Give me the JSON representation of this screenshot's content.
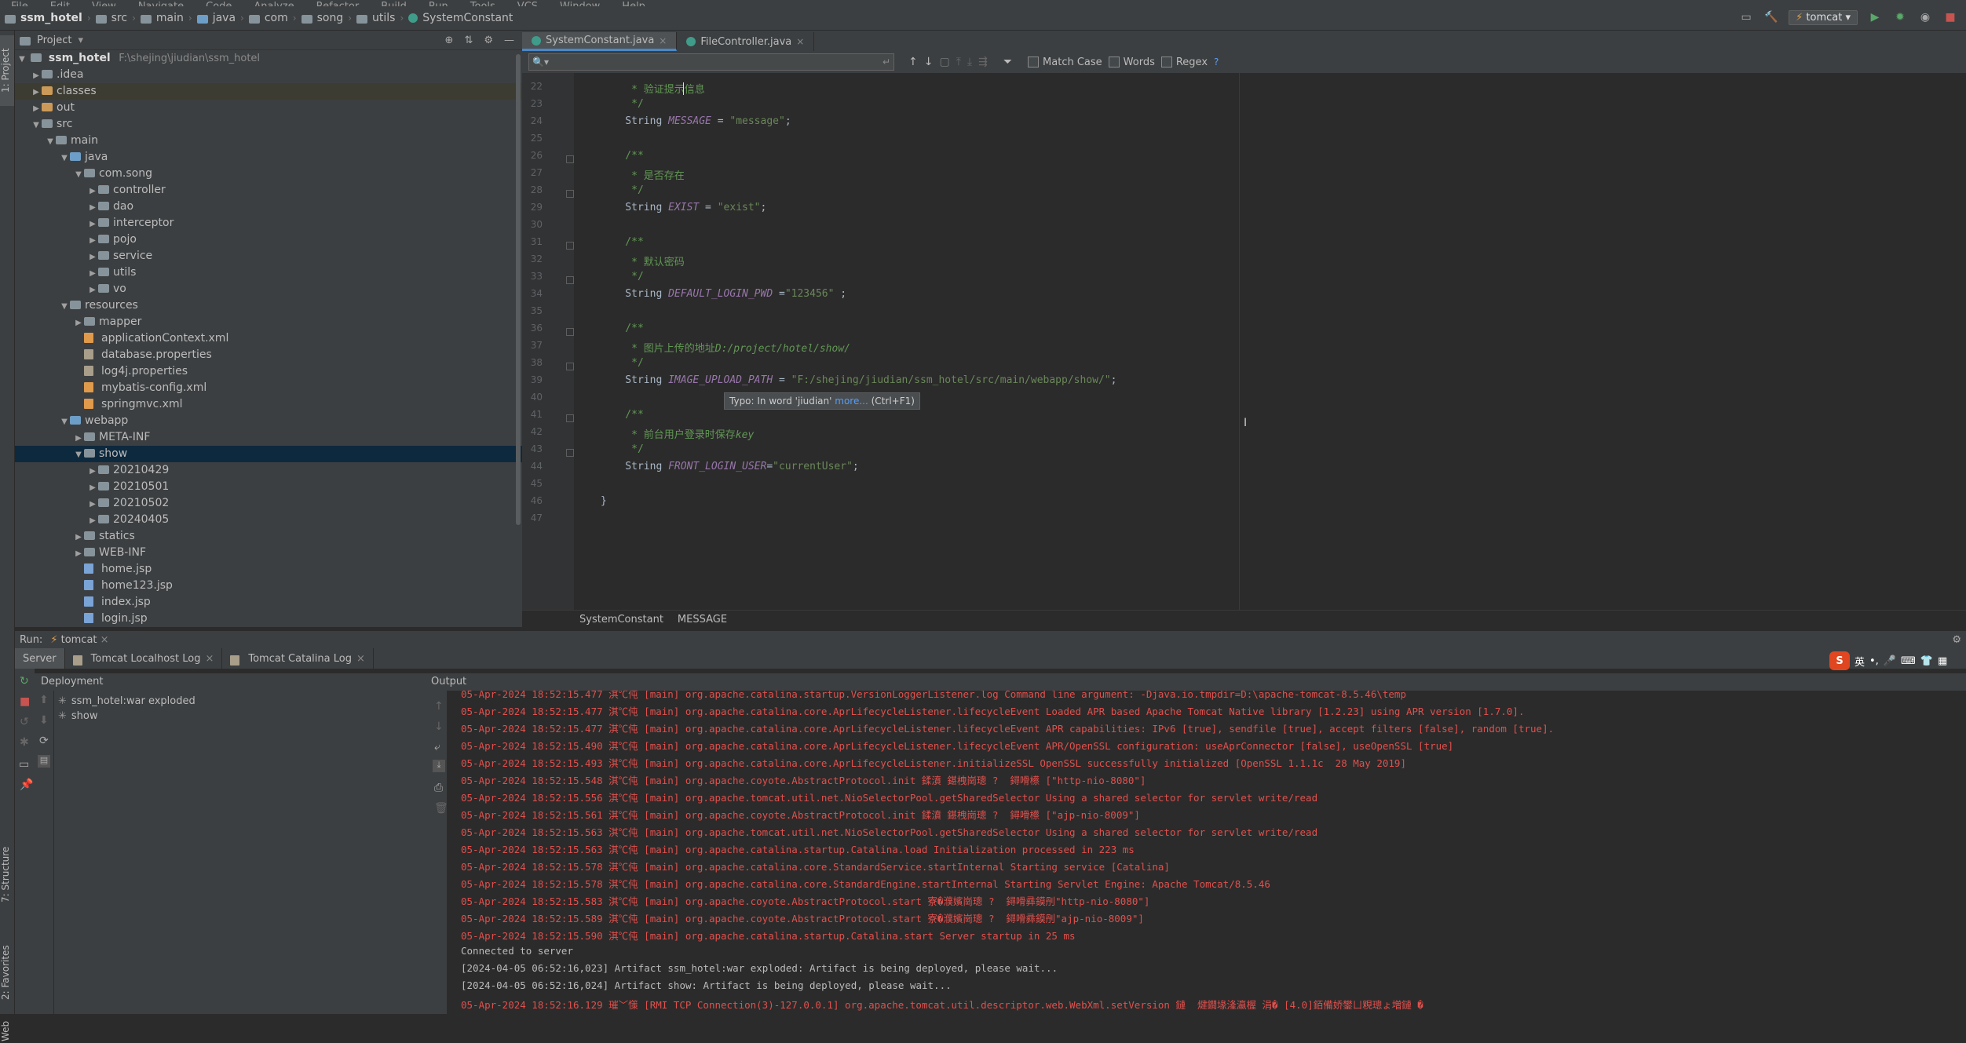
{
  "menubar": [
    "File",
    "Edit",
    "View",
    "Navigate",
    "Code",
    "Analyze",
    "Refactor",
    "Build",
    "Run",
    "Tools",
    "VCS",
    "Window",
    "Help"
  ],
  "navbar": {
    "crumbs": [
      "ssm_hotel",
      "src",
      "main",
      "java",
      "com",
      "song",
      "utils",
      "SystemConstant"
    ],
    "run_config": "tomcat"
  },
  "left_stripe": {
    "project": "1: Project",
    "structure": "7: Structure",
    "favorites": "2: Favorites",
    "web": "Web"
  },
  "project": {
    "title": "Project",
    "root_name": "ssm_hotel",
    "root_path": "F:\\shejing\\jiudian\\ssm_hotel",
    "items": [
      {
        "label": ".idea",
        "depth": 1,
        "kind": "folder",
        "expanded": false
      },
      {
        "label": "classes",
        "depth": 1,
        "kind": "folder-orange",
        "expanded": false
      },
      {
        "label": "out",
        "depth": 1,
        "kind": "folder-orange",
        "expanded": false
      },
      {
        "label": "src",
        "depth": 1,
        "kind": "folder",
        "expanded": true
      },
      {
        "label": "main",
        "depth": 2,
        "kind": "folder",
        "expanded": true
      },
      {
        "label": "java",
        "depth": 3,
        "kind": "folder-blue",
        "expanded": true
      },
      {
        "label": "com.song",
        "depth": 4,
        "kind": "folder",
        "expanded": true
      },
      {
        "label": "controller",
        "depth": 5,
        "kind": "folder",
        "expanded": false
      },
      {
        "label": "dao",
        "depth": 5,
        "kind": "folder",
        "expanded": false
      },
      {
        "label": "interceptor",
        "depth": 5,
        "kind": "folder",
        "expanded": false
      },
      {
        "label": "pojo",
        "depth": 5,
        "kind": "folder",
        "expanded": false
      },
      {
        "label": "service",
        "depth": 5,
        "kind": "folder",
        "expanded": false
      },
      {
        "label": "utils",
        "depth": 5,
        "kind": "folder",
        "expanded": false
      },
      {
        "label": "vo",
        "depth": 5,
        "kind": "folder",
        "expanded": false
      },
      {
        "label": "resources",
        "depth": 3,
        "kind": "folder",
        "expanded": true
      },
      {
        "label": "mapper",
        "depth": 4,
        "kind": "folder",
        "expanded": false
      },
      {
        "label": "applicationContext.xml",
        "depth": 4,
        "kind": "xml"
      },
      {
        "label": "database.properties",
        "depth": 4,
        "kind": "prop"
      },
      {
        "label": "log4j.properties",
        "depth": 4,
        "kind": "prop"
      },
      {
        "label": "mybatis-config.xml",
        "depth": 4,
        "kind": "xml"
      },
      {
        "label": "springmvc.xml",
        "depth": 4,
        "kind": "xml"
      },
      {
        "label": "webapp",
        "depth": 3,
        "kind": "folder-blue",
        "expanded": true
      },
      {
        "label": "META-INF",
        "depth": 4,
        "kind": "folder",
        "expanded": false
      },
      {
        "label": "show",
        "depth": 4,
        "kind": "folder",
        "expanded": true,
        "selected": true
      },
      {
        "label": "20210429",
        "depth": 5,
        "kind": "folder",
        "expanded": false
      },
      {
        "label": "20210501",
        "depth": 5,
        "kind": "folder",
        "expanded": false
      },
      {
        "label": "20210502",
        "depth": 5,
        "kind": "folder",
        "expanded": false
      },
      {
        "label": "20240405",
        "depth": 5,
        "kind": "folder",
        "expanded": false
      },
      {
        "label": "statics",
        "depth": 4,
        "kind": "folder",
        "expanded": false
      },
      {
        "label": "WEB-INF",
        "depth": 4,
        "kind": "folder",
        "expanded": false
      },
      {
        "label": "home.jsp",
        "depth": 4,
        "kind": "jsp"
      },
      {
        "label": "home123.jsp",
        "depth": 4,
        "kind": "jsp"
      },
      {
        "label": "index.jsp",
        "depth": 4,
        "kind": "jsp"
      },
      {
        "label": "login.jsp",
        "depth": 4,
        "kind": "jsp"
      }
    ]
  },
  "editor": {
    "tabs": [
      {
        "label": "SystemConstant.java",
        "active": true
      },
      {
        "label": "FileController.java",
        "active": false
      }
    ],
    "find": {
      "placeholder": "",
      "match_case": "Match Case",
      "words": "Words",
      "regex": "Regex",
      "help": "?"
    },
    "lines": [
      {
        "n": "22",
        "parts": [
          {
            "t": "     * 验证提示信息",
            "c": "cmt"
          }
        ]
      },
      {
        "n": "23",
        "parts": [
          {
            "t": "     */",
            "c": "cmt"
          }
        ]
      },
      {
        "n": "24",
        "parts": [
          {
            "t": "    String ",
            "c": "kw"
          },
          {
            "t": "MESSAGE",
            "c": "ital"
          },
          {
            "t": " = ",
            "c": "kw"
          },
          {
            "t": "\"message\"",
            "c": "str"
          },
          {
            "t": ";",
            "c": "kw"
          }
        ]
      },
      {
        "n": "25",
        "parts": []
      },
      {
        "n": "26",
        "parts": [
          {
            "t": "    /**",
            "c": "cmt"
          }
        ]
      },
      {
        "n": "27",
        "parts": [
          {
            "t": "     * 是否存在",
            "c": "cmt"
          }
        ]
      },
      {
        "n": "28",
        "parts": [
          {
            "t": "     */",
            "c": "cmt"
          }
        ]
      },
      {
        "n": "29",
        "parts": [
          {
            "t": "    String ",
            "c": "kw"
          },
          {
            "t": "EXIST",
            "c": "ital"
          },
          {
            "t": " = ",
            "c": "kw"
          },
          {
            "t": "\"exist\"",
            "c": "str"
          },
          {
            "t": ";",
            "c": "kw"
          }
        ]
      },
      {
        "n": "30",
        "parts": []
      },
      {
        "n": "31",
        "parts": [
          {
            "t": "    /**",
            "c": "cmt"
          }
        ]
      },
      {
        "n": "32",
        "parts": [
          {
            "t": "     * 默认密码",
            "c": "cmt"
          }
        ]
      },
      {
        "n": "33",
        "parts": [
          {
            "t": "     */",
            "c": "cmt"
          }
        ]
      },
      {
        "n": "34",
        "parts": [
          {
            "t": "    String ",
            "c": "kw"
          },
          {
            "t": "DEFAULT_LOGIN_PWD",
            "c": "ital"
          },
          {
            "t": " =",
            "c": "kw"
          },
          {
            "t": "\"123456\"",
            "c": "str"
          },
          {
            "t": " ;",
            "c": "kw"
          }
        ]
      },
      {
        "n": "35",
        "parts": []
      },
      {
        "n": "36",
        "parts": [
          {
            "t": "    /**",
            "c": "cmt"
          }
        ]
      },
      {
        "n": "37",
        "parts": [
          {
            "t": "     * 图片上传的地址",
            "c": "cmt"
          },
          {
            "t": "D:/project/hotel/show/",
            "c": "cmtital"
          }
        ]
      },
      {
        "n": "38",
        "parts": [
          {
            "t": "     */",
            "c": "cmt"
          }
        ]
      },
      {
        "n": "39",
        "parts": [
          {
            "t": "    String ",
            "c": "kw"
          },
          {
            "t": "IMAGE_UPLOAD_PATH",
            "c": "ital"
          },
          {
            "t": " = ",
            "c": "kw"
          },
          {
            "t": "\"F:/shejing/jiudian/ssm_hotel/src/main/webapp/show/\"",
            "c": "str"
          },
          {
            "t": ";",
            "c": "kw"
          }
        ]
      },
      {
        "n": "40",
        "parts": []
      },
      {
        "n": "41",
        "parts": [
          {
            "t": "    /**",
            "c": "cmt"
          }
        ]
      },
      {
        "n": "42",
        "parts": [
          {
            "t": "     * 前台用户登录时保存",
            "c": "cmt"
          },
          {
            "t": "key",
            "c": "cmtital"
          }
        ]
      },
      {
        "n": "43",
        "parts": [
          {
            "t": "     */",
            "c": "cmt"
          }
        ]
      },
      {
        "n": "44",
        "parts": [
          {
            "t": "    String ",
            "c": "kw"
          },
          {
            "t": "FRONT_LOGIN_USER",
            "c": "ital"
          },
          {
            "t": "=",
            "c": "kw"
          },
          {
            "t": "\"currentUser\"",
            "c": "str"
          },
          {
            "t": ";",
            "c": "kw"
          }
        ]
      },
      {
        "n": "45",
        "parts": []
      },
      {
        "n": "46",
        "parts": [
          {
            "t": "}",
            "c": "kw"
          }
        ]
      },
      {
        "n": "47",
        "parts": []
      }
    ],
    "tooltip": {
      "text": "Typo: In word 'jiudian'",
      "link": "more...",
      "shortcut": "(Ctrl+F1)"
    },
    "breadcrumb": [
      "SystemConstant",
      "MESSAGE"
    ]
  },
  "run": {
    "label": "Run:",
    "config": "tomcat",
    "tabs": [
      "Server",
      "Tomcat Localhost Log",
      "Tomcat Catalina Log"
    ],
    "deployment_title": "Deployment",
    "output_title": "Output",
    "deployments": [
      "ssm_hotel:war exploded",
      "show"
    ],
    "console": [
      {
        "c": "red",
        "t": "05-Apr-2024 18:52:15.477 淇℃伅 [main] org.apache.catalina.startup.VersionLoggerListener.log Command line argument: -Djava.io.tmpdir=D:\\apache-tomcat-8.5.46\\temp"
      },
      {
        "c": "red",
        "t": "05-Apr-2024 18:52:15.477 淇℃伅 [main] org.apache.catalina.core.AprLifecycleListener.lifecycleEvent Loaded APR based Apache Tomcat Native library [1.2.23] using APR version [1.7.0]."
      },
      {
        "c": "red",
        "t": "05-Apr-2024 18:52:15.477 淇℃伅 [main] org.apache.catalina.core.AprLifecycleListener.lifecycleEvent APR capabilities: IPv6 [true], sendfile [true], accept filters [false], random [true]."
      },
      {
        "c": "red",
        "t": "05-Apr-2024 18:52:15.490 淇℃伅 [main] org.apache.catalina.core.AprLifecycleListener.lifecycleEvent APR/OpenSSL configuration: useAprConnector [false], useOpenSSL [true]"
      },
      {
        "c": "red",
        "t": "05-Apr-2024 18:52:15.493 淇℃伅 [main] org.apache.catalina.core.AprLifecycleListener.initializeSSL OpenSSL successfully initialized [OpenSSL 1.1.1c  28 May 2019]"
      },
      {
        "c": "red",
        "t": "05-Apr-2024 18:52:15.548 淇℃伅 [main] org.apache.coyote.AbstractProtocol.init 鍒濆 鍖栧崗璁 ?  鐞嗗櫒 [\"http-nio-8080\"]"
      },
      {
        "c": "red",
        "t": "05-Apr-2024 18:52:15.556 淇℃伅 [main] org.apache.tomcat.util.net.NioSelectorPool.getSharedSelector Using a shared selector for servlet write/read"
      },
      {
        "c": "red",
        "t": "05-Apr-2024 18:52:15.561 淇℃伅 [main] org.apache.coyote.AbstractProtocol.init 鍒濆 鍖栧崗璁 ?  鐞嗗櫒 [\"ajp-nio-8009\"]"
      },
      {
        "c": "red",
        "t": "05-Apr-2024 18:52:15.563 淇℃伅 [main] org.apache.tomcat.util.net.NioSelectorPool.getSharedSelector Using a shared selector for servlet write/read"
      },
      {
        "c": "red",
        "t": "05-Apr-2024 18:52:15.563 淇℃伅 [main] org.apache.catalina.startup.Catalina.load Initialization processed in 223 ms"
      },
      {
        "c": "red",
        "t": "05-Apr-2024 18:52:15.578 淇℃伅 [main] org.apache.catalina.core.StandardService.startInternal Starting service [Catalina]"
      },
      {
        "c": "red",
        "t": "05-Apr-2024 18:52:15.578 淇℃伅 [main] org.apache.catalina.core.StandardEngine.startInternal Starting Servlet Engine: Apache Tomcat/8.5.46"
      },
      {
        "c": "red",
        "t": "05-Apr-2024 18:52:15.583 淇℃伅 [main] org.apache.coyote.AbstractProtocol.start 寮�濮嬪崗璁 ?  鐞嗗彞鏌刐\"http-nio-8080\"]"
      },
      {
        "c": "red",
        "t": "05-Apr-2024 18:52:15.589 淇℃伅 [main] org.apache.coyote.AbstractProtocol.start 寮�濮嬪崗璁 ?  鐞嗗彞鏌刐\"ajp-nio-8009\"]"
      },
      {
        "c": "red",
        "t": "05-Apr-2024 18:52:15.590 淇℃伅 [main] org.apache.catalina.startup.Catalina.start Server startup in 25 ms"
      },
      {
        "c": "plain",
        "t": "Connected to server"
      },
      {
        "c": "plain",
        "t": "[2024-04-05 06:52:16,023] Artifact ssm_hotel:war exploded: Artifact is being deployed, please wait..."
      },
      {
        "c": "plain",
        "t": "[2024-04-05 06:52:16,024] Artifact show: Artifact is being deployed, please wait..."
      },
      {
        "c": "red",
        "t": "05-Apr-2024 18:52:16.129 璀﹀憡 [RMI TCP Connection(3)-127.0.0.1] org.apache.tomcat.util.descriptor.web.WebXml.setVersion 鏈  煡鐗堟湰瀛楃 涓� [4.0]銆備娇鐢ㄩ粯璁ょ増鏈 �"
      }
    ]
  },
  "ime": {
    "lang": "英"
  }
}
